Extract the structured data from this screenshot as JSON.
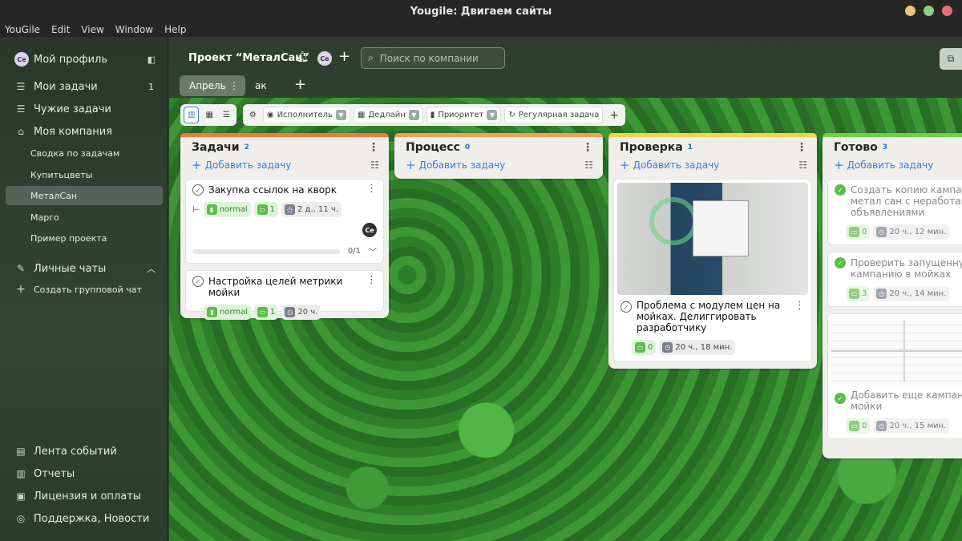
{
  "window": {
    "title": "Yougile: Двигаем сайты"
  },
  "menu": [
    "YouGile",
    "Edit",
    "View",
    "Window",
    "Help"
  ],
  "sidebar": {
    "profile": {
      "avatar": "Ce",
      "label": "Мой профиль"
    },
    "items": [
      {
        "label": "Мои задачи",
        "count": "1",
        "icon": "list-icon"
      },
      {
        "label": "Чужие задачи",
        "icon": "list-icon"
      },
      {
        "label": "Моя компания",
        "icon": "building-icon"
      }
    ],
    "company_items": [
      {
        "label": "Сводка по задачам"
      },
      {
        "label": "Купитьцветы"
      },
      {
        "label": "МеталСан",
        "active": true
      },
      {
        "label": "Марго"
      },
      {
        "label": "Пример проекта"
      }
    ],
    "chats": {
      "label": "Личные чаты",
      "create": "Создать групповой чат"
    },
    "bottom": [
      {
        "label": "Лента событий",
        "icon": "feed-icon"
      },
      {
        "label": "Отчеты",
        "icon": "report-icon"
      },
      {
        "label": "Лицензия и оплаты",
        "icon": "license-icon"
      },
      {
        "label": "Поддержка, Новости",
        "icon": "support-icon"
      }
    ]
  },
  "header": {
    "project": "Проект “МеталСан”",
    "avatar": "Ce",
    "search_placeholder": "Поиск по компании",
    "tabs": [
      {
        "label": "Апрель",
        "active": true
      },
      {
        "label": "ак"
      }
    ]
  },
  "toolbar": {
    "filters": [
      "Исполнитель",
      "Дедлайн",
      "Приоритет",
      "Регулярная задача"
    ]
  },
  "columns": [
    {
      "title": "Задачи",
      "count": "2",
      "color": "#f07a3a",
      "add": "Добавить задачу",
      "cards": [
        {
          "title": "Закупка ссылок на кворк",
          "priority": "normal",
          "comments": "1",
          "time": "2 д., 11 ч.",
          "avatar": "Ce",
          "progress": "0/1",
          "progress_value": 0
        },
        {
          "title": "Настройка целей метрики мойки",
          "priority": "normal",
          "comments": "1",
          "time": "20 ч."
        }
      ]
    },
    {
      "title": "Процесс",
      "count": "0",
      "color": "#f0a05a",
      "add": "Добавить задачу",
      "cards": []
    },
    {
      "title": "Проверка",
      "count": "1",
      "color": "#f2d34a",
      "add": "Добавить задачу",
      "cards": [
        {
          "title": "Проблема с модулем цен на мойках. Делиггировать разработчику",
          "comments": "0",
          "time": "20 ч., 18 мин."
        }
      ]
    },
    {
      "title": "Готово",
      "count": "3",
      "color": "#6fce4a",
      "add": "Добавить задачу",
      "cards": [
        {
          "title": "Создать копию кампании метал сан с неработающими объявлениями",
          "comments": "0",
          "time": "20 ч., 12 мин."
        },
        {
          "title": "Проверить запущенную кампанию в мойках",
          "comments": "3",
          "time": "20 ч., 14 мин."
        },
        {
          "title": "Добавить еще кампаний мойки",
          "comments": "0",
          "time": "20 ч., 15 мин."
        }
      ]
    }
  ]
}
